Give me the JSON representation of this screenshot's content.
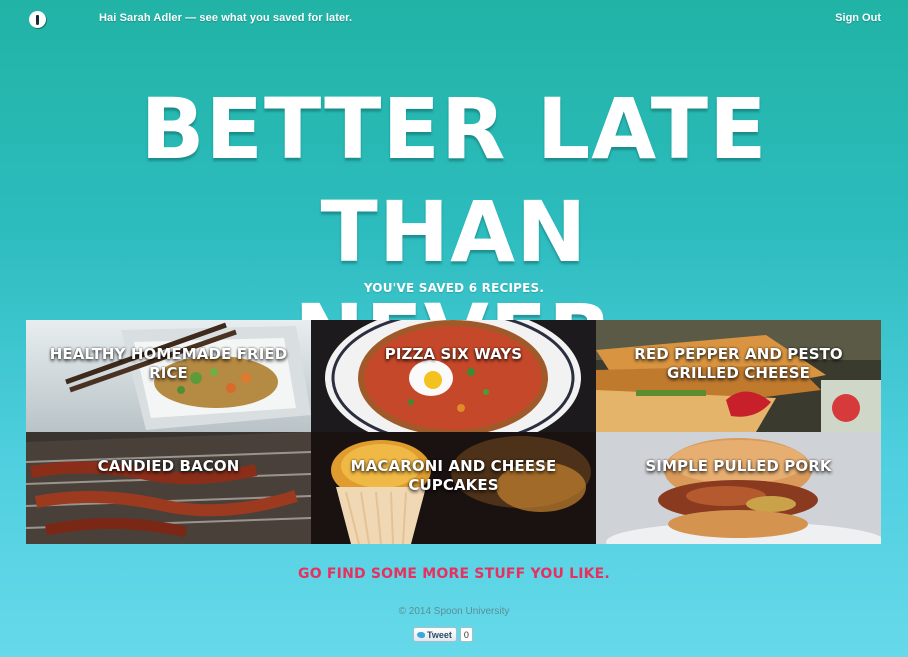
{
  "header": {
    "greeting": "Hai Sarah Adler — see what you saved for later.",
    "sign_out": "Sign Out"
  },
  "hero": {
    "line1": "BETTER LATE THAN",
    "line2": "NEVER",
    "subtitle": "YOU'VE SAVED 6 RECIPES."
  },
  "recipes": [
    {
      "title": "HEALTHY HOMEMADE FRIED RICE"
    },
    {
      "title": "PIZZA SIX WAYS"
    },
    {
      "title": "RED PEPPER AND PESTO GRILLED CHEESE"
    },
    {
      "title": "CANDIED BACON"
    },
    {
      "title": "MACARONI AND CHEESE CUPCAKES"
    },
    {
      "title": "SIMPLE PULLED PORK"
    }
  ],
  "cta": {
    "find_more": "GO FIND SOME MORE STUFF YOU LIKE."
  },
  "footer": {
    "copyright": "© 2014 Spoon University",
    "tweet_label": "Tweet",
    "tweet_count": "0"
  },
  "colors": {
    "accent": "#e8305f",
    "background_top": "#21b3a5",
    "background_bottom": "#66d9ea"
  }
}
